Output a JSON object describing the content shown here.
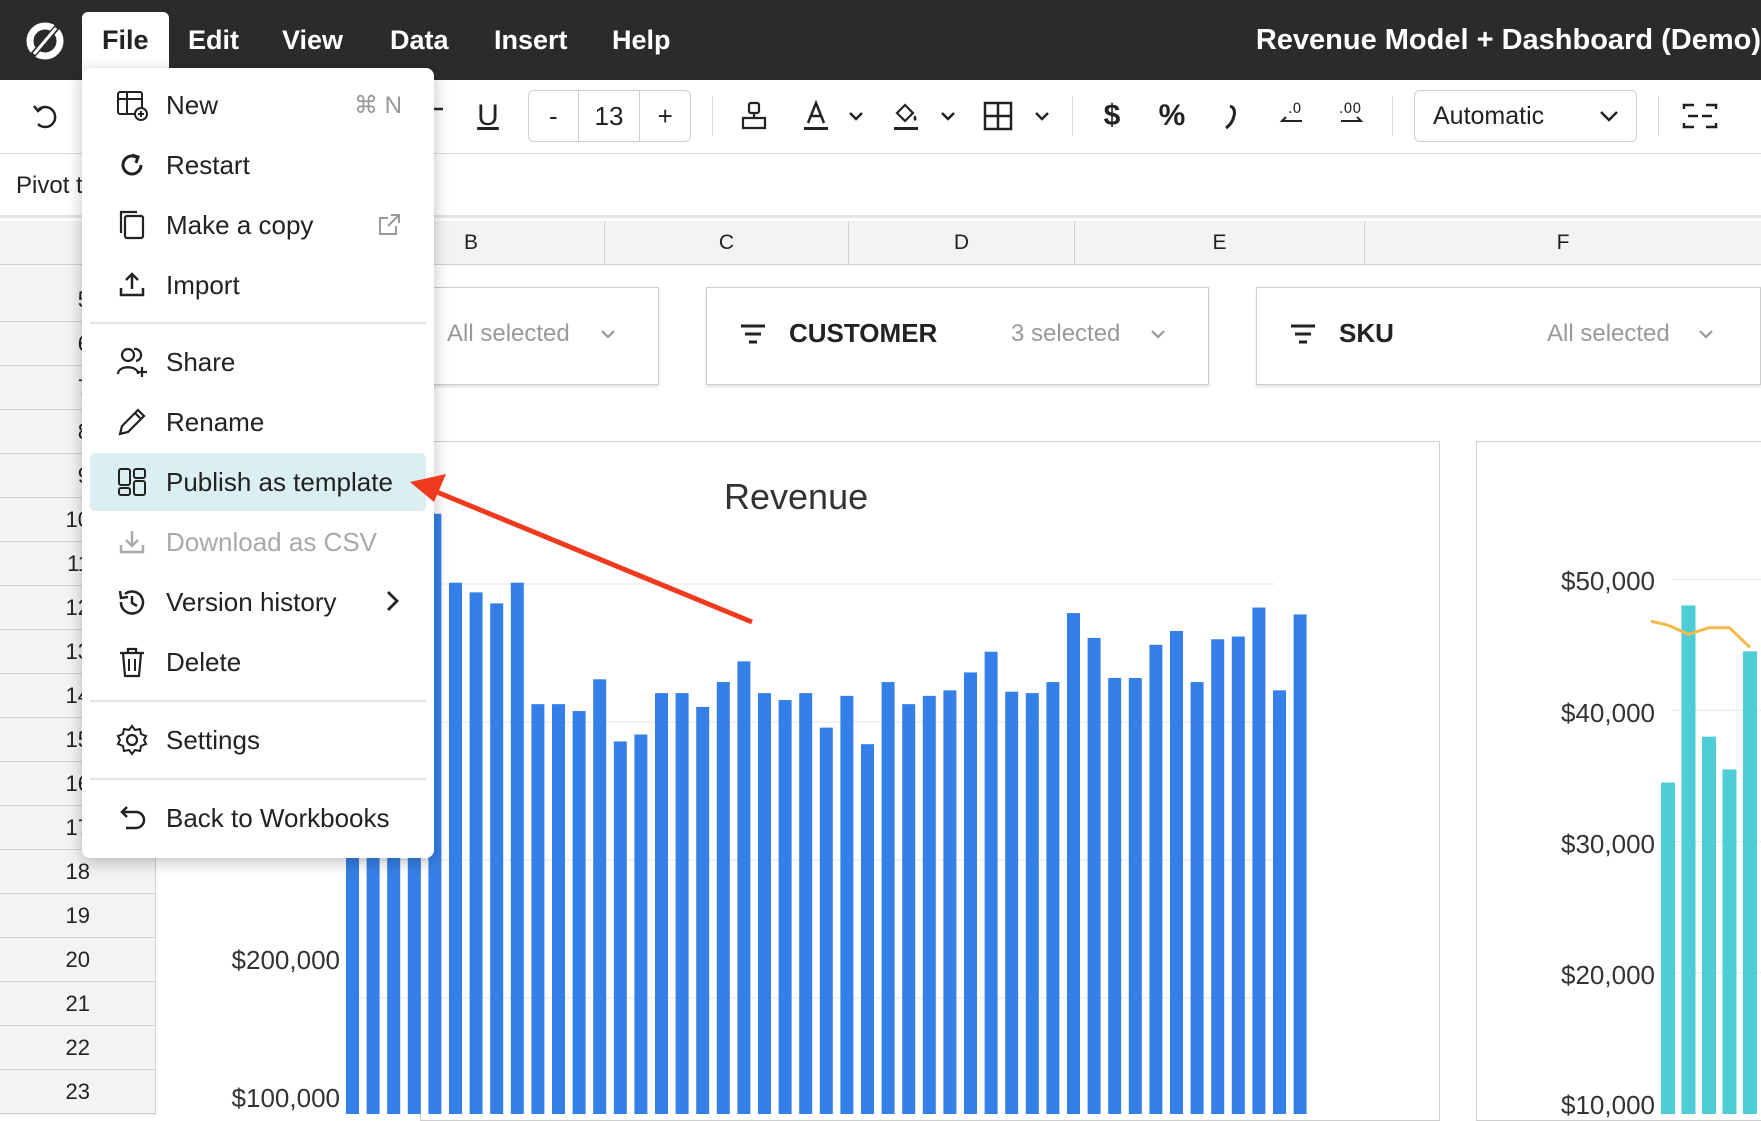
{
  "app": {
    "title": "Revenue Model + Dashboard (Demo)"
  },
  "menubar": {
    "items": [
      "File",
      "Edit",
      "View",
      "Data",
      "Insert",
      "Help"
    ],
    "active": "File"
  },
  "toolbar": {
    "font_size": "13",
    "minus": "-",
    "plus": "+",
    "underline": "U",
    "currency": "$",
    "percent": "%",
    "number_format": "Automatic"
  },
  "pivot": {
    "label": "Pivot t"
  },
  "columns": [
    "B",
    "C",
    "D",
    "E",
    "F"
  ],
  "rows": [
    "5",
    "6",
    "7",
    "8",
    "9",
    "10",
    "11",
    "12",
    "13",
    "14",
    "15",
    "16",
    "17",
    "18",
    "19",
    "20",
    "21",
    "22",
    "23"
  ],
  "filters": [
    {
      "name": "",
      "value": "All selected"
    },
    {
      "name": "CUSTOMER",
      "value": "3 selected"
    },
    {
      "name": "SKU",
      "value": "All selected"
    }
  ],
  "file_menu": {
    "items": [
      {
        "label": "New",
        "icon": "new-sheet-icon",
        "shortcut": "⌘ N"
      },
      {
        "label": "Restart",
        "icon": "restart-icon"
      },
      {
        "label": "Make a copy",
        "icon": "copy-icon",
        "right_icon": "external-link-icon"
      },
      {
        "label": "Import",
        "icon": "import-icon"
      },
      {
        "label": "Share",
        "icon": "share-user-icon"
      },
      {
        "label": "Rename",
        "icon": "pencil-icon"
      },
      {
        "label": "Publish as template",
        "icon": "template-icon",
        "highlighted": true
      },
      {
        "label": "Download as CSV",
        "icon": "download-icon",
        "disabled": true
      },
      {
        "label": "Version history",
        "icon": "history-icon",
        "right_icon": "chevron-right-icon"
      },
      {
        "label": "Delete",
        "icon": "trash-icon"
      },
      {
        "label": "Settings",
        "icon": "gear-icon"
      },
      {
        "label": "Back to Workbooks",
        "icon": "back-icon"
      }
    ]
  },
  "chart_data": [
    {
      "type": "bar",
      "title": "Revenue",
      "y_ticks": [
        "$200,000",
        "$100,000"
      ],
      "ylim": [
        0,
        400000
      ],
      "values": [
        400000,
        400000,
        400000,
        400000,
        435000,
        385000,
        378000,
        370000,
        385000,
        297000,
        297000,
        292000,
        315000,
        270000,
        275000,
        305000,
        305000,
        295000,
        313000,
        328000,
        305000,
        300000,
        305000,
        280000,
        303000,
        268000,
        313000,
        297000,
        303000,
        307000,
        320000,
        335000,
        306000,
        305000,
        313000,
        363000,
        345000,
        316000,
        316000,
        340000,
        350000,
        313000,
        344000,
        346000,
        367000,
        307000,
        362000
      ],
      "color": "#3580e8"
    },
    {
      "type": "bar",
      "y_ticks": [
        "$50,000",
        "$40,000",
        "$30,000",
        "$20,000",
        "$10,000"
      ],
      "ylim": [
        0,
        55000
      ],
      "values": [
        34500,
        48000,
        38000,
        35500,
        44500
      ],
      "line_values": [
        46500,
        45800,
        46300,
        46300,
        44800
      ],
      "color": "#4ecdd6",
      "line_color": "#f5b94a"
    }
  ]
}
